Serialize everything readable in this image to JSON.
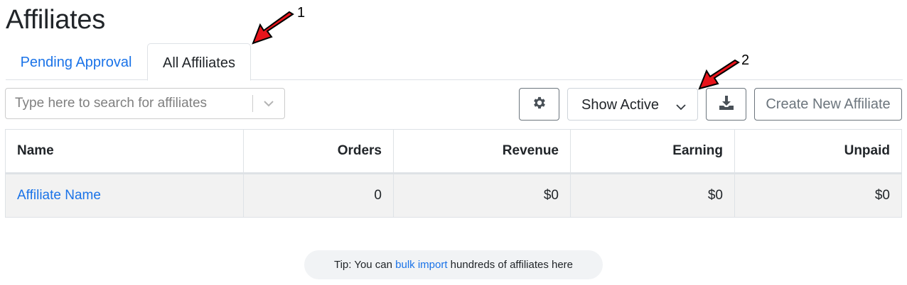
{
  "page": {
    "title": "Affiliates"
  },
  "tabs": [
    {
      "label": "Pending Approval",
      "active": false
    },
    {
      "label": "All Affiliates",
      "active": true
    }
  ],
  "toolbar": {
    "search": {
      "placeholder": "Type here to search for affiliates",
      "value": ""
    },
    "settings_icon": "gear-icon",
    "status_filter": {
      "selected": "Show Active"
    },
    "export_icon": "download-icon",
    "create_label": "Create New Affiliate"
  },
  "table": {
    "columns": [
      "Name",
      "Orders",
      "Revenue",
      "Earning",
      "Unpaid"
    ],
    "rows": [
      {
        "name": "Affiliate Name",
        "orders": "0",
        "revenue": "$0",
        "earning": "$0",
        "unpaid": "$0"
      }
    ]
  },
  "tip": {
    "prefix": "Tip: You can ",
    "link": "bulk import",
    "suffix": " hundreds of affiliates here"
  },
  "annotations": [
    {
      "label": "1"
    },
    {
      "label": "2"
    }
  ],
  "colors": {
    "link": "#1a73e8",
    "annotation_arrow": "#e8141b",
    "row_bg": "#f2f2f2"
  }
}
